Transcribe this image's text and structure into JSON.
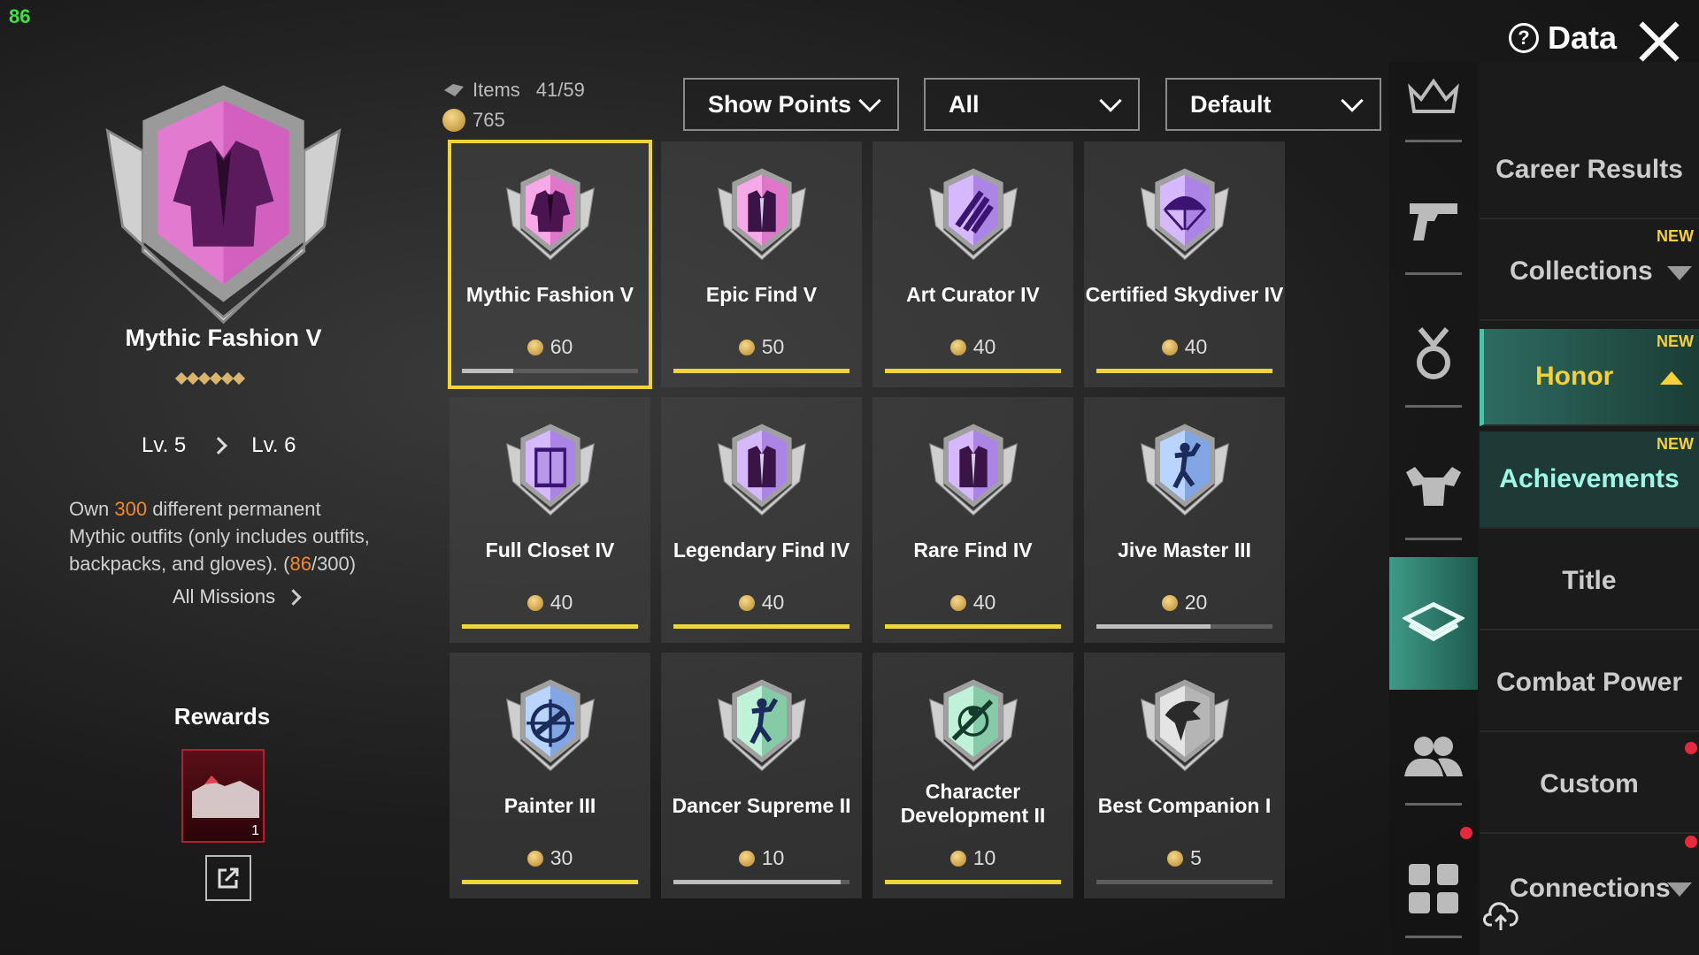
{
  "fps": "86",
  "header": {
    "data_label": "Data",
    "items_label": "Items",
    "items_count": "41/59",
    "points_total": "765",
    "filters": [
      "Show Points",
      "All",
      "Default"
    ]
  },
  "detail": {
    "title": "Mythic Fashion V",
    "stars": 6,
    "level_from": "Lv. 5",
    "level_to": "Lv. 6",
    "desc_pre": "Own ",
    "desc_num": "300",
    "desc_mid": " different permanent Mythic outfits (only includes outfits, backpacks, and gloves). (",
    "desc_progress": "86",
    "desc_post": "/300)",
    "all_missions": "All Missions",
    "rewards_label": "Rewards",
    "reward_count": "1"
  },
  "achievements": [
    {
      "name": "Mythic Fashion V",
      "points": "60",
      "progress": 0.29,
      "bar": "grey",
      "tier": "mythic",
      "icon": "jacket"
    },
    {
      "name": "Epic Find V",
      "points": "50",
      "progress": 1.0,
      "bar": "yellow",
      "tier": "mythic",
      "icon": "vest"
    },
    {
      "name": "Art Curator IV",
      "points": "40",
      "progress": 1.0,
      "bar": "yellow",
      "tier": "epic",
      "icon": "claw"
    },
    {
      "name": "Certified Skydiver IV",
      "points": "40",
      "progress": 1.0,
      "bar": "yellow",
      "tier": "epic",
      "icon": "parachute"
    },
    {
      "name": "Full Closet IV",
      "points": "40",
      "progress": 1.0,
      "bar": "yellow",
      "tier": "epic",
      "icon": "closet"
    },
    {
      "name": "Legendary Find IV",
      "points": "40",
      "progress": 1.0,
      "bar": "yellow",
      "tier": "epic",
      "icon": "vest"
    },
    {
      "name": "Rare Find IV",
      "points": "40",
      "progress": 1.0,
      "bar": "yellow",
      "tier": "epic",
      "icon": "vest"
    },
    {
      "name": "Jive Master III",
      "points": "20",
      "progress": 0.65,
      "bar": "grey",
      "tier": "rare",
      "icon": "dancer"
    },
    {
      "name": "Painter III",
      "points": "30",
      "progress": 1.0,
      "bar": "yellow",
      "tier": "rare",
      "icon": "crosshair"
    },
    {
      "name": "Dancer Supreme II",
      "points": "10",
      "progress": 0.95,
      "bar": "grey",
      "tier": "uncommon",
      "icon": "dancer"
    },
    {
      "name": "Character Development II",
      "points": "10",
      "progress": 1.0,
      "bar": "yellow",
      "tier": "uncommon",
      "icon": "sword"
    },
    {
      "name": "Best Companion I",
      "points": "5",
      "progress": 0.0,
      "bar": "grey",
      "tier": "common",
      "icon": "eagle"
    }
  ],
  "tier_colors": {
    "mythic": [
      "#f7a8e6",
      "#c23aa8"
    ],
    "epic": [
      "#d6b8ff",
      "#7a45c8"
    ],
    "rare": [
      "#b8d4ff",
      "#3f6fc2"
    ],
    "uncommon": [
      "#bff2d6",
      "#3e9c6e"
    ],
    "common": [
      "#e4e4e4",
      "#7d7d7d"
    ]
  },
  "menu": {
    "career": "Career Results",
    "collections": "Collections",
    "honor": "Honor",
    "achievements": "Achievements",
    "title": "Title",
    "combat": "Combat Power",
    "custom": "Custom",
    "connections": "Connections",
    "new_tag": "NEW"
  },
  "rail_icons": [
    "crown-icon",
    "pistol-icon",
    "medal-icon",
    "muscle-icon",
    "chest-icon",
    "friends-icon",
    "grid-icon"
  ]
}
